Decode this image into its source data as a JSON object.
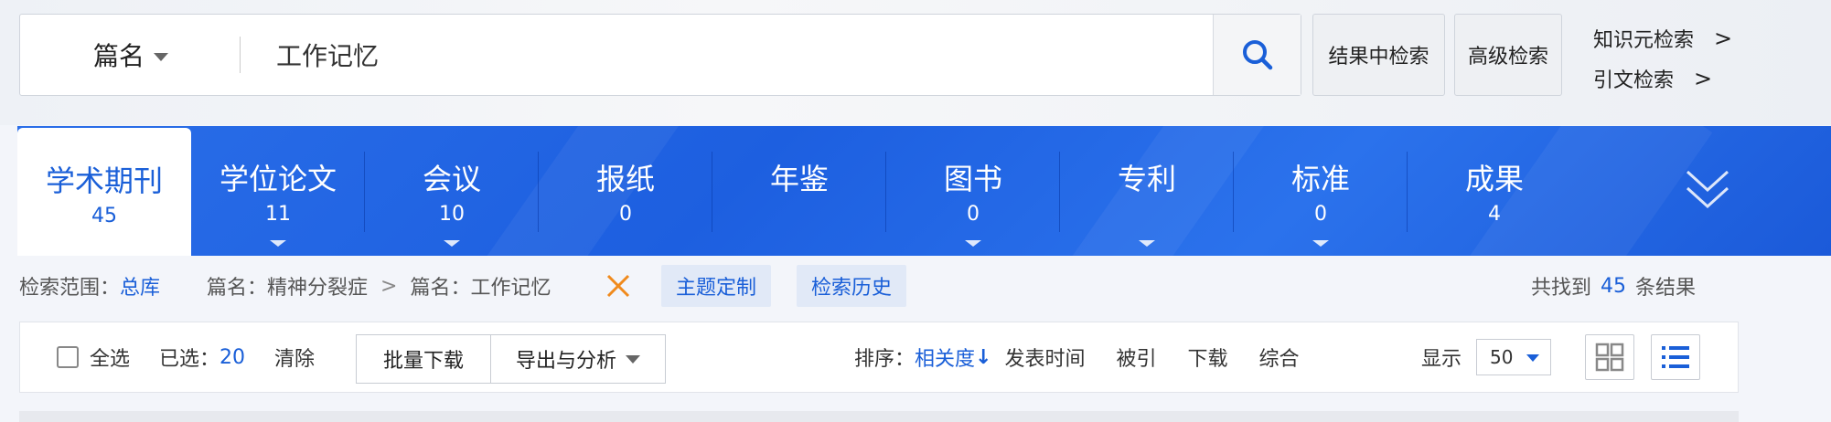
{
  "search": {
    "field": "篇名",
    "query": "工作记忆",
    "refine_label": "结果中检索",
    "advanced_label": "高级检索",
    "side_links": [
      {
        "label": "知识元检索",
        "arrow": ">"
      },
      {
        "label": "引文检索",
        "arrow": ">"
      }
    ]
  },
  "tabs": [
    {
      "label": "学术期刊",
      "count": "45",
      "active": true
    },
    {
      "label": "学位论文",
      "count": "11"
    },
    {
      "label": "会议",
      "count": "10"
    },
    {
      "label": "报纸",
      "count": "0"
    },
    {
      "label": "年鉴",
      "count": ""
    },
    {
      "label": "图书",
      "count": "0"
    },
    {
      "label": "专利",
      "count": ""
    },
    {
      "label": "标准",
      "count": "0"
    },
    {
      "label": "成果",
      "count": "4"
    }
  ],
  "scope": {
    "range_label": "检索范围：",
    "range_value": "总库",
    "crumb1": "篇名：精神分裂症",
    "sep": ">",
    "crumb2": "篇名：工作记忆",
    "close_glyph": "✕",
    "topic_btn": "主题定制",
    "history_btn": "检索历史",
    "found_prefix": "共找到",
    "found_count": "45",
    "found_suffix": "条结果"
  },
  "toolbar": {
    "select_all": "全选",
    "selected_label": "已选：",
    "selected_count": "20",
    "clear": "清除",
    "batch_download": "批量下载",
    "export_analyze": "导出与分析",
    "sort_label": "排序：",
    "sort_active": "相关度",
    "sort_arrow": "↓",
    "sort_options": [
      "发表时间",
      "被引",
      "下载",
      "综合"
    ],
    "display_label": "显示",
    "page_size": "50"
  },
  "colors": {
    "accent": "#1a5fd8",
    "tab_band": "#2468e6",
    "close_icon": "#f08a1c"
  },
  "icons": {
    "search": "search-icon",
    "expand": "double-chevron-down-icon",
    "grid_view": "grid-view-icon",
    "list_view": "list-view-icon"
  }
}
